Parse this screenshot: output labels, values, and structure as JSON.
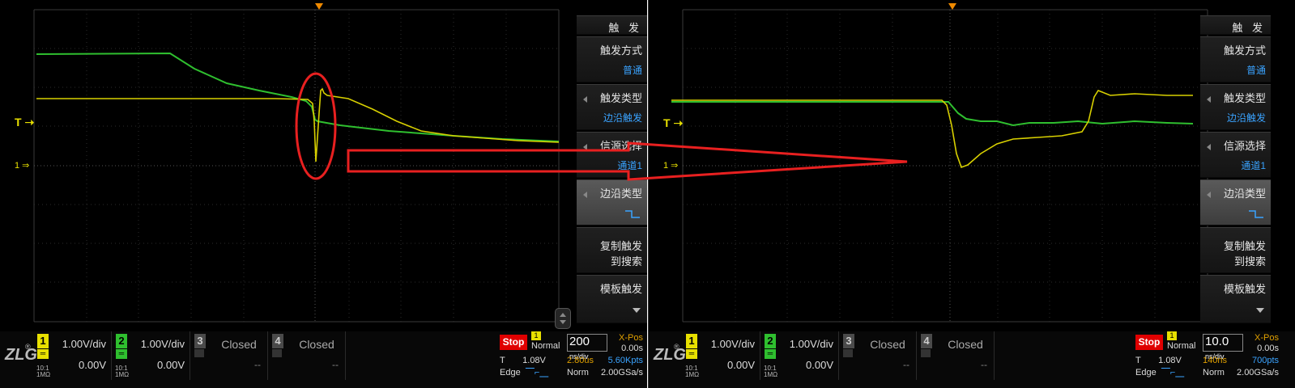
{
  "colors": {
    "ch1": "#e8e000",
    "ch2": "#2fbf2f",
    "accent": "#3aa3ff",
    "stop": "#e00000",
    "annotation": "#e82020"
  },
  "screens": [
    {
      "markers": {
        "trigger": "T",
        "ch1": "1"
      },
      "menu": {
        "title": "触 发",
        "items": [
          {
            "label": "触发方式",
            "value": "普通"
          },
          {
            "label": "触发类型",
            "value": "边沿触发"
          },
          {
            "label": "信源选择",
            "value": "通道1"
          },
          {
            "label": "边沿类型",
            "value": "falling-edge-icon"
          },
          {
            "label": "复制触发",
            "label2": "到搜索"
          },
          {
            "label": "模板触发"
          }
        ]
      },
      "channels": [
        {
          "num": "1",
          "volts_div": "1.00V/div",
          "offset": "0.00V",
          "impedance": "10:1\n1MΩ"
        },
        {
          "num": "2",
          "volts_div": "1.00V/div",
          "offset": "0.00V",
          "impedance": "10:1\n1MΩ"
        },
        {
          "num": "3",
          "state": "Closed",
          "offset": "--"
        },
        {
          "num": "4",
          "state": "Closed",
          "offset": "--"
        }
      ],
      "run_state": "Stop",
      "trigger": {
        "ch": "1",
        "mode": "Normal",
        "level_label": "T",
        "level": "1.08V",
        "type": "Edge"
      },
      "timebase": {
        "value": "200",
        "unit": "ns/div",
        "xpos_label": "X-Pos",
        "xpos": "0.00s"
      },
      "acquisition": {
        "time": "2.80us",
        "points": "5.60Kpts",
        "mode": "Norm",
        "rate": "2.00GSa/s"
      }
    },
    {
      "markers": {
        "trigger": "T",
        "ch1": "1"
      },
      "menu": {
        "title": "触 发",
        "items": [
          {
            "label": "触发方式",
            "value": "普通"
          },
          {
            "label": "触发类型",
            "value": "边沿触发"
          },
          {
            "label": "信源选择",
            "value": "通道1"
          },
          {
            "label": "边沿类型",
            "value": "falling-edge-icon"
          },
          {
            "label": "复制触发",
            "label2": "到搜索"
          },
          {
            "label": "模板触发"
          }
        ]
      },
      "channels": [
        {
          "num": "1",
          "volts_div": "1.00V/div",
          "offset": "0.00V",
          "impedance": "10:1\n1MΩ"
        },
        {
          "num": "2",
          "volts_div": "1.00V/div",
          "offset": "0.00V",
          "impedance": "10:1\n1MΩ"
        },
        {
          "num": "3",
          "state": "Closed",
          "offset": "--"
        },
        {
          "num": "4",
          "state": "Closed",
          "offset": "--"
        }
      ],
      "run_state": "Stop",
      "trigger": {
        "ch": "1",
        "mode": "Normal",
        "level_label": "T",
        "level": "1.08V",
        "type": "Edge"
      },
      "timebase": {
        "value": "10.0",
        "unit": "ns/div",
        "xpos_label": "X-Pos",
        "xpos": "0.00s"
      },
      "acquisition": {
        "time": "140ns",
        "points": "700pts",
        "mode": "Norm",
        "rate": "2.00GSa/s"
      }
    }
  ]
}
